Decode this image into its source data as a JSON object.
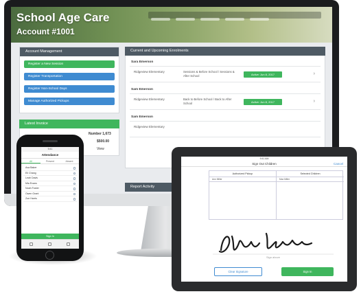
{
  "app": {
    "title": "School Age Care",
    "account": "Account #1001"
  },
  "left_panel": {
    "heading": "Account Management",
    "actions": [
      {
        "label": "Register a New Session",
        "style": "green"
      },
      {
        "label": "Register Transportation",
        "style": "blue"
      },
      {
        "label": "Register Non-School Days",
        "style": "blue"
      },
      {
        "label": "Manage Authorized Pickups",
        "style": "blue"
      }
    ],
    "latest_invoice": {
      "heading": "Latest Invoice",
      "number_line": "Number 1,673",
      "amount": "$500.00",
      "link": "View"
    }
  },
  "right_panel": {
    "heading": "Current and Upcoming Enrolments",
    "children": [
      {
        "name": "Sara Emerson",
        "school": "Ridgeview Elementary",
        "schedule": "Sessions & Before School / Sessions & After School",
        "status": "Active: Jun 8, 2017"
      },
      {
        "name": "Sam Emerson",
        "school": "Ridgeview Elementary",
        "schedule": "Back to Before School / Back to After School",
        "status": "Active: Jun 8, 2017"
      },
      {
        "name": "Sam Emerson",
        "school": "Ridgeview Elementary",
        "schedule": "",
        "status": ""
      }
    ]
  },
  "report_heading": "Report Activity",
  "phone": {
    "status": "9:41",
    "title": "Attendance",
    "tabs": [
      "All",
      "Present",
      "Absent"
    ],
    "rows": [
      "Ava Baker",
      "Eli Chang",
      "Leah Davis",
      "Mia Evans",
      "Noah Foster",
      "Owen Grant",
      "Zoe Harris"
    ],
    "footer": "Sign In"
  },
  "tablet": {
    "status": "9:41 AM",
    "title": "Sign Out Children",
    "cancel": "Cancel",
    "columns": [
      {
        "heading": "Authorized Pickup",
        "sub": "Ann Miller"
      },
      {
        "heading": "Selected Children",
        "sub": "Max Miller"
      }
    ],
    "signature_caption": "Sign above",
    "clear_button": "Clear Signature",
    "done_button": "Sign In"
  }
}
